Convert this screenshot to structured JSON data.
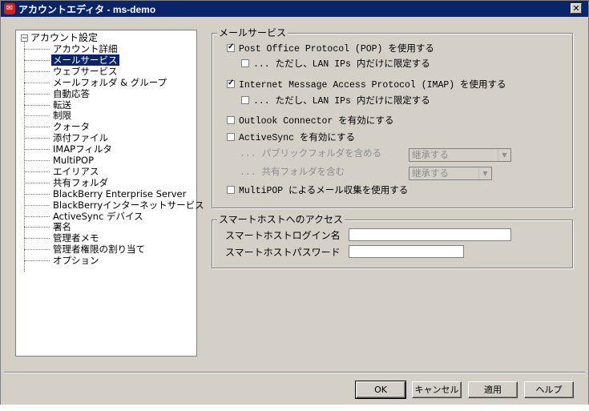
{
  "window": {
    "title": "アカウントエディタ - ms-demo",
    "close_glyph": "✕"
  },
  "tree": {
    "root_toggle": "−",
    "root_label": "アカウント設定",
    "items": [
      {
        "label": "アカウント詳細",
        "selected": false
      },
      {
        "label": "メールサービス",
        "selected": true
      },
      {
        "label": "ウェブサービス",
        "selected": false
      },
      {
        "label": "メールフォルダ & グループ",
        "selected": false
      },
      {
        "label": "自動応答",
        "selected": false
      },
      {
        "label": "転送",
        "selected": false
      },
      {
        "label": "制限",
        "selected": false
      },
      {
        "label": "クォータ",
        "selected": false
      },
      {
        "label": "添付ファイル",
        "selected": false
      },
      {
        "label": "IMAPフィルタ",
        "selected": false
      },
      {
        "label": "MultiPOP",
        "selected": false
      },
      {
        "label": "エイリアス",
        "selected": false
      },
      {
        "label": "共有フォルダ",
        "selected": false
      },
      {
        "label": "BlackBerry Enterprise Server",
        "selected": false
      },
      {
        "label": "BlackBerryインターネットサービス",
        "selected": false
      },
      {
        "label": "ActiveSync デバイス",
        "selected": false
      },
      {
        "label": "署名",
        "selected": false
      },
      {
        "label": "管理者メモ",
        "selected": false
      },
      {
        "label": "管理者権限の割り当て",
        "selected": false
      },
      {
        "label": "オプション",
        "selected": false
      }
    ]
  },
  "mail_services": {
    "title": "メールサービス",
    "pop": {
      "label": "Post Office Protocol (POP) を使用する",
      "checked": true
    },
    "pop_lan": {
      "label": "... ただし、LAN IPs 内だけに限定する",
      "checked": false
    },
    "imap": {
      "label": "Internet Message Access Protocol (IMAP) を使用する",
      "checked": true
    },
    "imap_lan": {
      "label": "... ただし、LAN IPs 内だけに限定する",
      "checked": false
    },
    "outlook_connector": {
      "label": "Outlook Connector を有効にする",
      "checked": false
    },
    "activesync": {
      "label": "ActiveSync を有効にする",
      "checked": false
    },
    "public_folders": {
      "label": "... パブリックフォルダを含める",
      "value": "継承する"
    },
    "shared_folders": {
      "label": "... 共有フォルダを含む",
      "value": "継承する"
    },
    "multipop": {
      "label": "MultiPOP によるメール収集を使用する",
      "checked": false
    }
  },
  "smarthost": {
    "title": "スマートホストへのアクセス",
    "login_label": "スマートホストログイン名",
    "login_value": "",
    "password_label": "スマートホストパスワード",
    "password_value": ""
  },
  "buttons": {
    "ok": "OK",
    "cancel": "キャンセル",
    "apply": "適用",
    "help": "ヘルプ"
  },
  "check_glyph": "✓",
  "dropdown_glyph": "▼",
  "colors": {
    "titlebar": "#0a246a",
    "dialog_bg": "#d4d0c8",
    "selection": "#0a246a"
  }
}
